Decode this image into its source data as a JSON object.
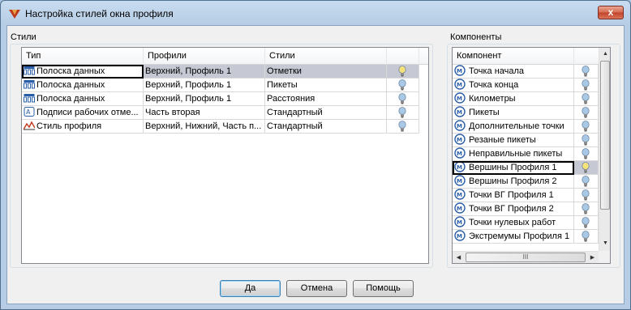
{
  "window": {
    "title": "Настройка стилей окна профиля",
    "close_glyph": "x"
  },
  "styles_group": {
    "label": "Стили",
    "columns": [
      "Тип",
      "Профили",
      "Стили"
    ],
    "rows": [
      {
        "type_icon": "data-band-icon",
        "type": "Полоска данных",
        "profiles": "Верхний, Профиль 1",
        "style": "Отметки",
        "bulb": "lightbulb-on-icon",
        "selected": true
      },
      {
        "type_icon": "data-band-icon",
        "type": "Полоска данных",
        "profiles": "Верхний, Профиль 1",
        "style": "Пикеты",
        "bulb": "lightbulb-off-icon",
        "selected": false
      },
      {
        "type_icon": "data-band-icon",
        "type": "Полоска данных",
        "profiles": "Верхний, Профиль 1",
        "style": "Расстояния",
        "bulb": "lightbulb-off-icon",
        "selected": false
      },
      {
        "type_icon": "label-icon",
        "type": "Подписи рабочих отме...",
        "profiles": "Часть вторая",
        "style": "Стандартный",
        "bulb": "lightbulb-off-icon",
        "selected": false
      },
      {
        "type_icon": "profile-style-icon",
        "type": "Стиль профиля",
        "profiles": "Верхний, Нижний, Часть п...",
        "style": "Стандартный",
        "bulb": "lightbulb-off-icon",
        "selected": false
      }
    ]
  },
  "components_group": {
    "label": "Компоненты",
    "column": "Компонент",
    "items": [
      {
        "label": "Точка начала",
        "focused": false
      },
      {
        "label": "Точка конца",
        "focused": false
      },
      {
        "label": "Километры",
        "focused": false
      },
      {
        "label": "Пикеты",
        "focused": false
      },
      {
        "label": "Дополнительные точки",
        "focused": false
      },
      {
        "label": "Резаные пикеты",
        "focused": false
      },
      {
        "label": "Неправильные пикеты",
        "focused": false
      },
      {
        "label": "Вершины Профиля 1",
        "focused": true
      },
      {
        "label": "Вершины Профиля 2",
        "focused": false
      },
      {
        "label": "Точки ВГ Профиля 1",
        "focused": false
      },
      {
        "label": "Точки ВГ Профиля 2",
        "focused": false
      },
      {
        "label": "Точки нулевых работ",
        "focused": false
      },
      {
        "label": "Экстремумы Профиля 1",
        "focused": false
      }
    ],
    "hscroll_thumb_glyph": "III"
  },
  "buttons": {
    "ok": "Да",
    "cancel": "Отмена",
    "help": "Помощь"
  },
  "colors": {
    "selection": "#c6c9d4",
    "bulb_on": "#f6e27a",
    "bulb_off": "#a9c8e6"
  }
}
